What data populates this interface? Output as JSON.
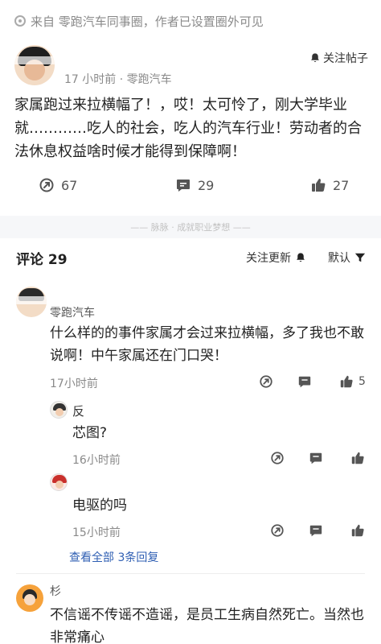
{
  "source": {
    "text": "来自 零跑汽车同事圈，作者已设置圈外可见"
  },
  "post": {
    "meta": "17 小时前 · 零跑汽车",
    "follow_label": "关注帖子",
    "text": "家属跑过来拉横幅了！，哎！太可怜了，刚大学毕业就…………吃人的社会，吃人的汽车行业！劳动者的合法休息权益啥时候才能得到保障啊！",
    "forward_count": "67",
    "comment_count": "29",
    "like_count": "27"
  },
  "divider": {
    "text": "—— 脉脉 · 成就职业梦想 ——"
  },
  "comments_header": {
    "title": "评论 29",
    "follow_updates_label": "关注更新",
    "sort_label": "默认"
  },
  "comments": [
    {
      "name": "零跑汽车",
      "text": "什么样的的事件家属才会过来拉横幅，多了我也不敢说啊！中午家属还在门口哭！",
      "time": "17小时前",
      "like_count": "5"
    },
    {
      "name": "反",
      "text": "芯图?",
      "time": "16小时前"
    },
    {
      "name": "",
      "text": "电驱的吗",
      "time": "15小时前"
    },
    {
      "name": "杉",
      "text": "不信谣不传谣不造谣，是员工生病自然死亡。当然也非常痛心"
    }
  ],
  "view_all": "查看全部 3条回复",
  "colors": {
    "link": "#2f5fb3",
    "muted": "#8a8a8a",
    "band": "#f6f7f9"
  }
}
